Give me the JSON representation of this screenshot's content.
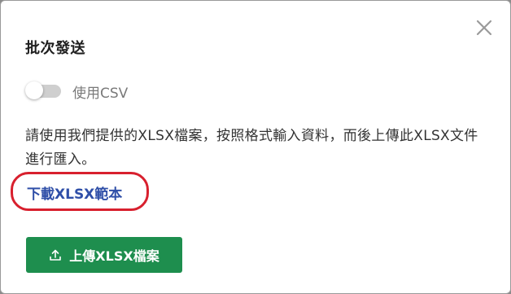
{
  "dialog": {
    "title": "批次發送",
    "close_icon": "close-icon"
  },
  "toggle": {
    "label": "使用CSV",
    "checked": false
  },
  "description": "請使用我們提供的XLSX檔案，按照格式輸入資料，而後上傳此XLSX文件進行匯入。",
  "download_link": {
    "label": "下載XLSX範本"
  },
  "upload_button": {
    "label": "上傳XLSX檔案",
    "icon": "upload-icon",
    "color": "#1e8e4e"
  },
  "colors": {
    "link": "#2f4fa8",
    "highlight": "#d8202e"
  }
}
